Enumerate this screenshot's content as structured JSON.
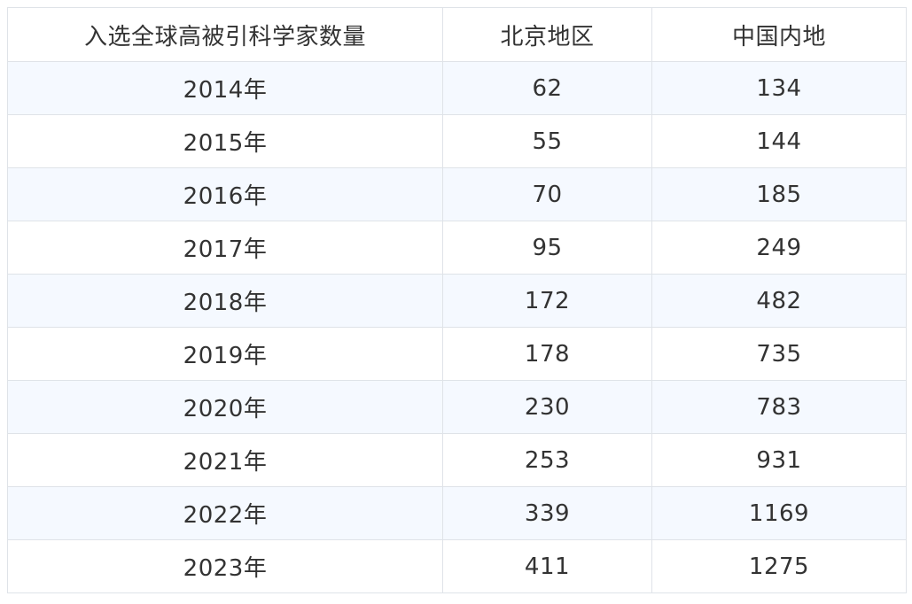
{
  "table": {
    "headers": [
      "入选全球高被引科学家数量",
      "北京地区",
      "中国内地"
    ],
    "rows": [
      [
        "2014年",
        "62",
        "134"
      ],
      [
        "2015年",
        "55",
        "144"
      ],
      [
        "2016年",
        "70",
        "185"
      ],
      [
        "2017年",
        "95",
        "249"
      ],
      [
        "2018年",
        "172",
        "482"
      ],
      [
        "2019年",
        "178",
        "735"
      ],
      [
        "2020年",
        "230",
        "783"
      ],
      [
        "2021年",
        "253",
        "931"
      ],
      [
        "2022年",
        "339",
        "1169"
      ],
      [
        "2023年",
        "411",
        "1275"
      ]
    ]
  }
}
